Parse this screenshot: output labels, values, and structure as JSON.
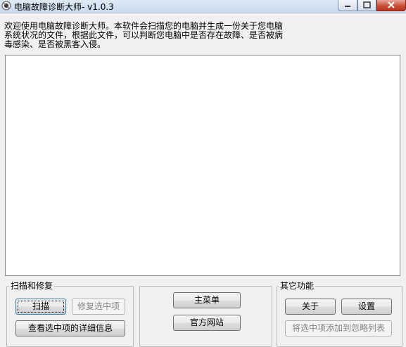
{
  "window": {
    "title": "电脑故障诊断大师- v1.0.3",
    "icon": "app-icon"
  },
  "description": {
    "lines": [
      "欢迎使用电脑故障诊断大师。本软件会扫描您的电脑并生成一份关于您电脑",
      "系统状况的文件，根据此文件，可以判断您电脑中是否存在故障、是否被病",
      "毒感染、是否被黑客入侵。"
    ]
  },
  "output_area": {
    "value": ""
  },
  "scan_repair": {
    "title": "扫描和修复",
    "scan_label": "扫描",
    "repair_label": "修复选中项",
    "details_label": "查看选中项的详细信息"
  },
  "center": {
    "main_menu_label": "主菜单",
    "website_label": "官方网站"
  },
  "other": {
    "title": "其它功能",
    "about_label": "关于",
    "settings_label": "设置",
    "ignore_label": "将选中项添加到忽略列表"
  }
}
